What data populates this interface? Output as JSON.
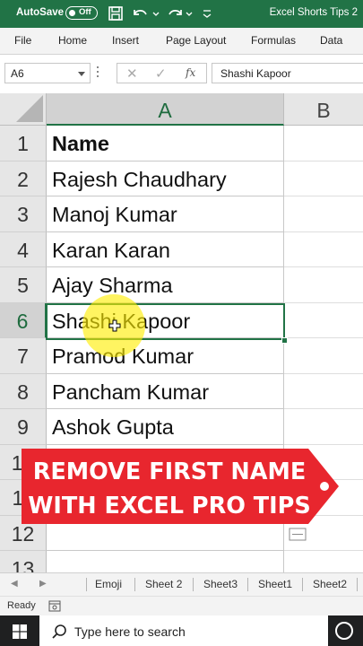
{
  "titlebar": {
    "autosave_label": "AutoSave",
    "autosave_state": "Off",
    "filename": "Excel Shorts Tips 2"
  },
  "ribbon": {
    "tabs": [
      "File",
      "Home",
      "Insert",
      "Page Layout",
      "Formulas",
      "Data"
    ]
  },
  "formula_bar": {
    "name_box": "A6",
    "fx_label": "fx",
    "formula": "Shashi Kapoor"
  },
  "grid": {
    "columns": [
      "A",
      "B"
    ],
    "rows": [
      {
        "num": "1",
        "value": "Name"
      },
      {
        "num": "2",
        "value": "Rajesh Chaudhary"
      },
      {
        "num": "3",
        "value": "Manoj Kumar"
      },
      {
        "num": "4",
        "value": "Karan Karan"
      },
      {
        "num": "5",
        "value": "Ajay Sharma"
      },
      {
        "num": "6",
        "value": "Shashi Kapoor"
      },
      {
        "num": "7",
        "value": "Pramod Kumar"
      },
      {
        "num": "8",
        "value": "Pancham Kumar"
      },
      {
        "num": "9",
        "value": "Ashok Gupta"
      },
      {
        "num": "10",
        "value": ""
      },
      {
        "num": "11",
        "value": ""
      },
      {
        "num": "12",
        "value": ""
      },
      {
        "num": "13",
        "value": ""
      }
    ]
  },
  "banner": {
    "line1": "REMOVE FIRST NAME",
    "line2": "WITH EXCEL PRO TIPS",
    "color": "#e8262e"
  },
  "sheet_tabs": [
    "Emoji",
    "Sheet 2",
    "Sheet3",
    "Sheet1",
    "Sheet2"
  ],
  "status": {
    "ready": "Ready"
  },
  "taskbar": {
    "search_placeholder": "Type here to search"
  },
  "colors": {
    "excel_green": "#217346",
    "highlight": "#ffee00"
  }
}
